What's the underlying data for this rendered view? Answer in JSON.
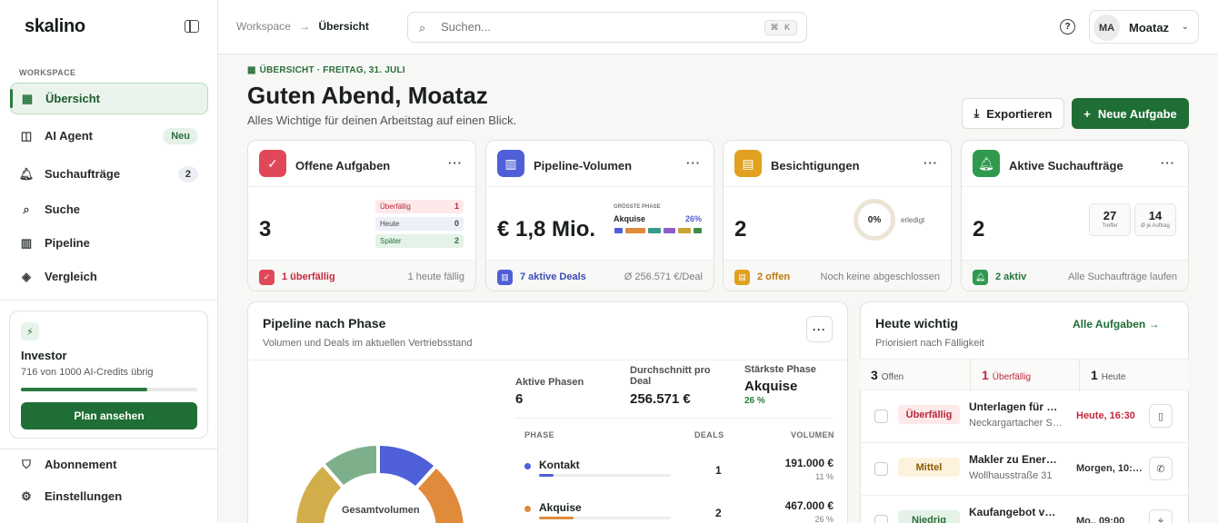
{
  "app": {
    "logo": "skalino"
  },
  "sidebar": {
    "section": "WORKSPACE",
    "items": [
      {
        "label": "Übersicht",
        "icon": "grid-icon",
        "active": true
      },
      {
        "label": "AI Agent",
        "icon": "bot-icon",
        "badge": "Neu"
      },
      {
        "label": "Suchaufträge",
        "icon": "bell-icon",
        "badge": "2"
      },
      {
        "label": "Suche",
        "icon": "search-icon"
      },
      {
        "label": "Pipeline",
        "icon": "kanban-icon"
      },
      {
        "label": "Vergleich",
        "icon": "layers-icon"
      }
    ],
    "plan": {
      "title": "Investor",
      "credits": "716 von 1000 AI-Credits übrig",
      "progress": 0.716,
      "button": "Plan ansehen"
    },
    "bottom": [
      {
        "label": "Abonnement",
        "icon": "shield-icon"
      },
      {
        "label": "Einstellungen",
        "icon": "gear-icon"
      }
    ]
  },
  "topbar": {
    "breadcrumb": {
      "root": "Workspace",
      "sep": "→",
      "current": "Übersicht"
    },
    "search_placeholder": "Suchen...",
    "shortcut": "⌘ K",
    "user": {
      "initials": "MA",
      "name": "Moataz"
    }
  },
  "header": {
    "eyebrow": "ÜBERSICHT · FREITAG, 31. JULI",
    "title": "Guten Abend, Moataz",
    "subtitle": "Alles Wichtige für deinen Arbeitstag auf einen Blick.",
    "export": "Exportieren",
    "new_task": "Neue Aufgabe"
  },
  "kpis": [
    {
      "title": "Offene Aufgaben",
      "value": "3",
      "color": "#e0485a",
      "rows": [
        {
          "label": "Überfällig",
          "value": "1"
        },
        {
          "label": "Heute",
          "value": "0"
        },
        {
          "label": "Später",
          "value": "2"
        }
      ],
      "foot_left": "1 überfällig",
      "foot_right": "1 heute fällig"
    },
    {
      "title": "Pipeline-Volumen",
      "value": "€ 1,8 Mio.",
      "color": "#4e5fd8",
      "phase_label": "GRÖSSTE PHASE",
      "phase_name": "Akquise",
      "phase_pct": "26%",
      "foot_left": "7 aktive Deals",
      "foot_right": "Ø 256.571 €/Deal"
    },
    {
      "title": "Besichtigungen",
      "value": "2",
      "color": "#e0a020",
      "ring": "0%",
      "ring_label": "erledigt",
      "ring_progress": 0,
      "foot_left": "2 offen",
      "foot_right": "Noch keine abgeschlossen"
    },
    {
      "title": "Aktive Suchaufträge",
      "value": "2",
      "color": "#2f9a4e",
      "mini": [
        {
          "value": "27",
          "label": "Treffer"
        },
        {
          "value": "14",
          "label": "Ø je Auftrag"
        }
      ],
      "foot_left": "2 aktiv",
      "foot_right": "Alle Suchaufträge laufen"
    }
  ],
  "pipeline": {
    "title": "Pipeline nach Phase",
    "subtitle": "Volumen und Deals im aktuellen Vertriebsstand",
    "stats": [
      {
        "label": "Aktive Phasen",
        "value": "6"
      },
      {
        "label": "Durchschnitt pro Deal",
        "value": "256.571 €"
      },
      {
        "label": "Stärkste Phase",
        "value": "Akquise",
        "extra": "26 %"
      }
    ],
    "headers": {
      "phase": "PHASE",
      "deals": "DEALS",
      "volume": "VOLUMEN"
    },
    "rows": [
      {
        "name": "Kontakt",
        "deals": "1",
        "volume": "191.000 €",
        "pct": "11 %",
        "share": 0.11,
        "color": "#4e5fd8"
      },
      {
        "name": "Akquise",
        "deals": "2",
        "volume": "467.000 €",
        "pct": "26 %",
        "share": 0.26,
        "color": "#e08a3c"
      }
    ],
    "donut_label": "Gesamtvolumen"
  },
  "today": {
    "title": "Heute wichtig",
    "subtitle": "Priorisiert nach Fälligkeit",
    "link": "Alle Aufgaben",
    "counts": [
      {
        "n": "3",
        "label": "Offen"
      },
      {
        "n": "1",
        "label": "Überfällig"
      },
      {
        "n": "1",
        "label": "Heute"
      }
    ],
    "tasks": [
      {
        "badge": "Überfällig",
        "title": "Unterlagen für …",
        "sub": "Neckargartacher S…",
        "due": "Heute, 16:30",
        "action": "file-icon"
      },
      {
        "badge": "Mittel",
        "title": "Makler zu Ener…",
        "sub": "Wollhausstraße 31",
        "due": "Morgen, 10:…",
        "action": "phone-icon"
      },
      {
        "badge": "Niedrig",
        "title": "Kaufangebot v…",
        "sub": "",
        "due": "Mo., 09:00",
        "action": "pin-icon"
      }
    ]
  }
}
